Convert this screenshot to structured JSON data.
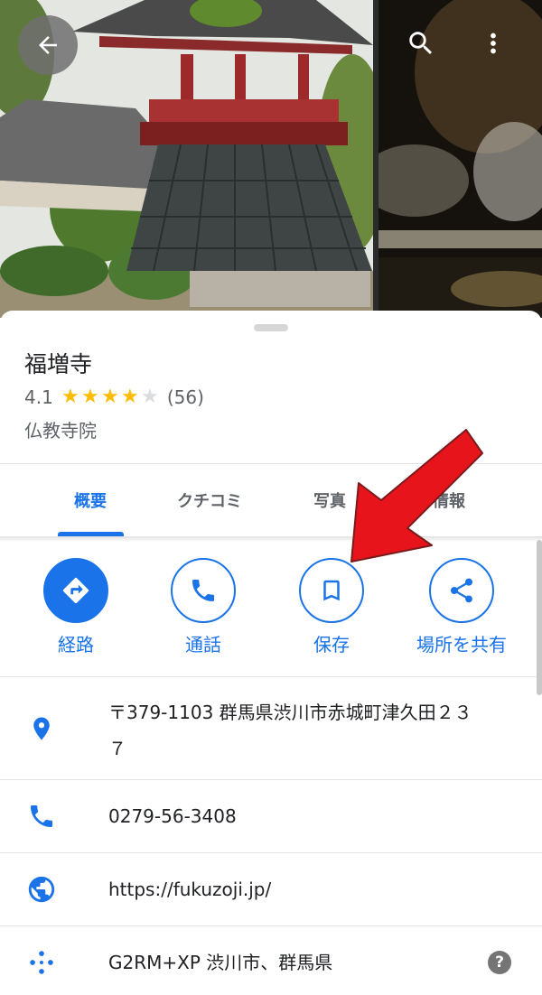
{
  "header": {
    "back_icon": "arrow-back-icon",
    "search_icon": "search-icon",
    "more_icon": "more-vert-icon"
  },
  "place": {
    "name": "福増寺",
    "rating": "4.1",
    "rating_value": 4.1,
    "review_count": "(56)",
    "category": "仏教寺院"
  },
  "tabs": [
    {
      "label": "概要",
      "active": true
    },
    {
      "label": "クチコミ",
      "active": false
    },
    {
      "label": "写真",
      "active": false
    },
    {
      "label": "情報",
      "active": false
    }
  ],
  "actions": [
    {
      "label": "経路",
      "icon": "directions-icon"
    },
    {
      "label": "通話",
      "icon": "phone-icon"
    },
    {
      "label": "保存",
      "icon": "bookmark-icon"
    },
    {
      "label": "場所を共有",
      "icon": "share-icon"
    }
  ],
  "info": {
    "address_line1": "〒379-1103 群馬県渋川市赤城町津久田２３",
    "address_line2": "７",
    "phone": "0279-56-3408",
    "website": "https://fukuzoji.jp/",
    "plus_code": "G2RM+XP 渋川市、群馬県",
    "help_symbol": "?"
  },
  "colors": {
    "accent": "#1a73e8",
    "star": "#fbbc04",
    "annotation_arrow": "#e8141c"
  }
}
